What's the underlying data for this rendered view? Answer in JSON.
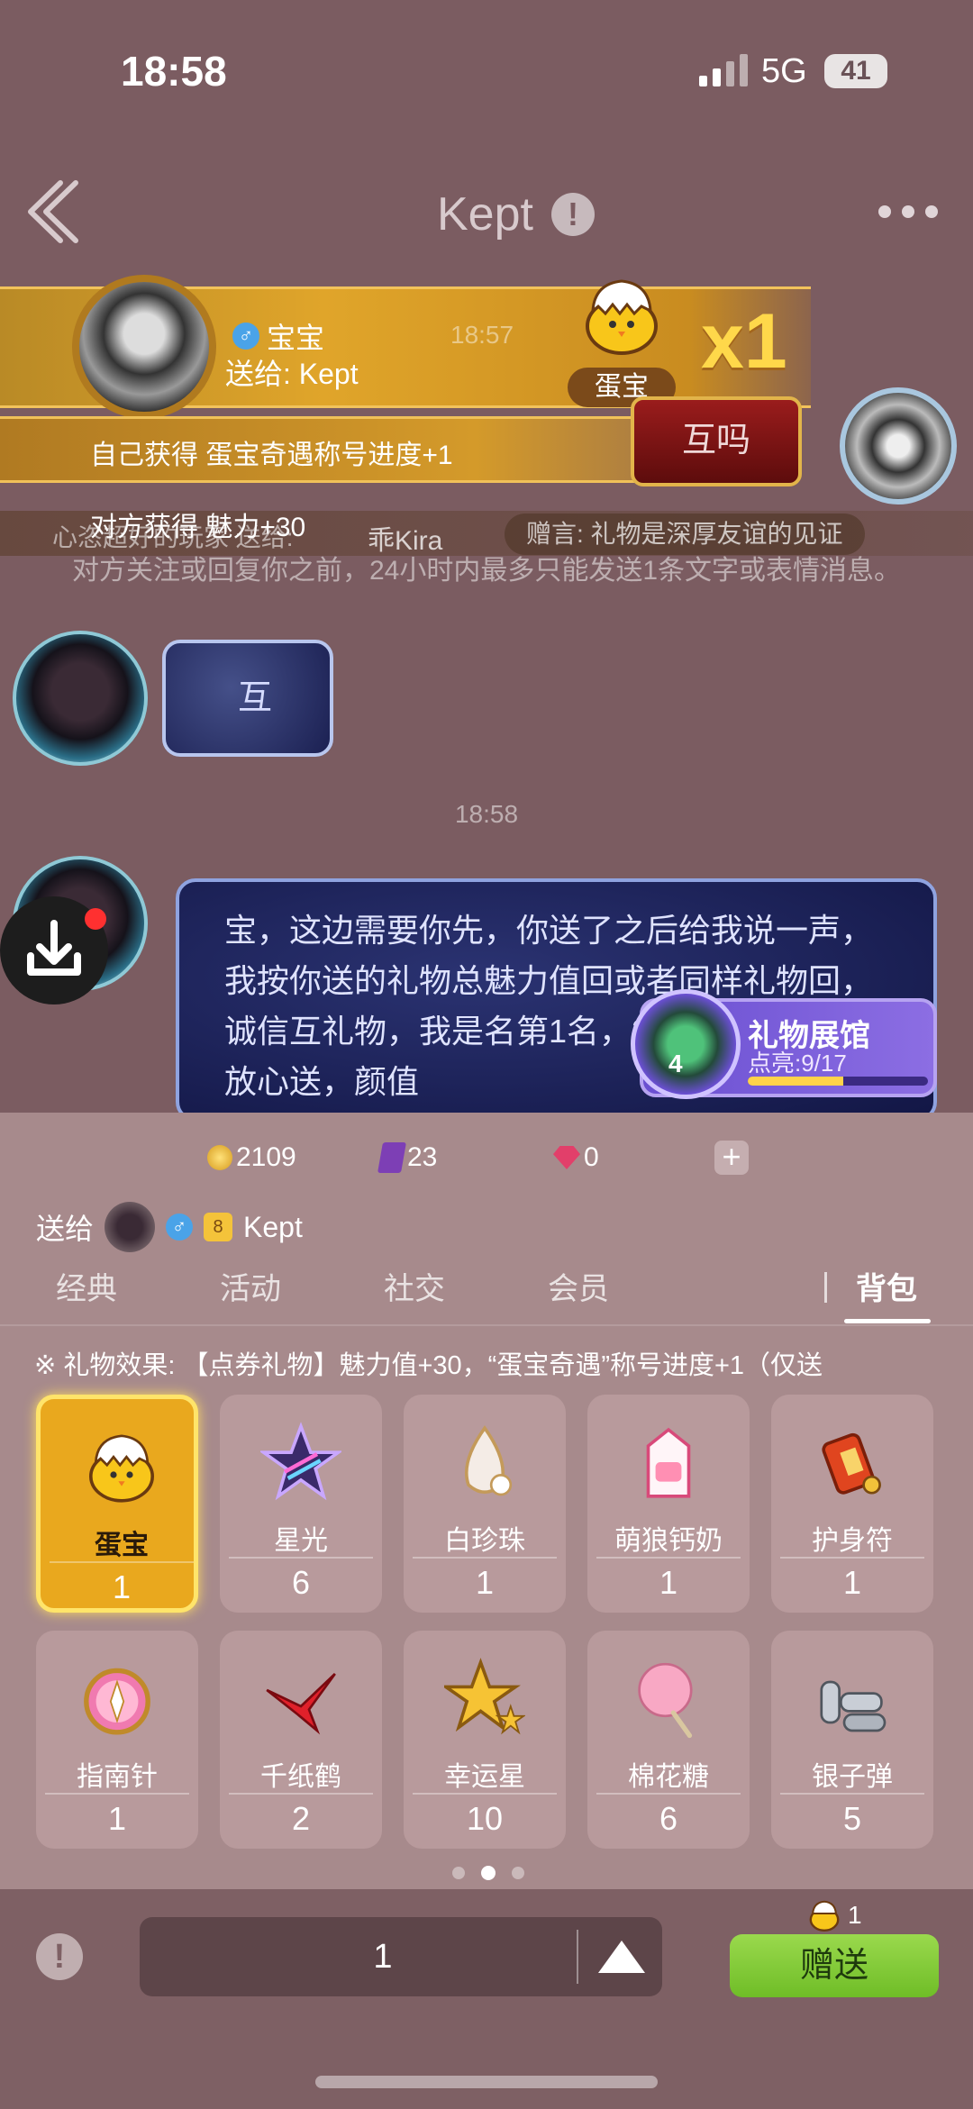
{
  "status_bar": {
    "time": "18:58",
    "network": "5G",
    "battery": "41"
  },
  "header": {
    "title": "Kept"
  },
  "gift_banner": {
    "sender_name": "宝宝",
    "to_text": "送给: Kept",
    "time": "18:57",
    "gift_name": "蛋宝",
    "multiplier": "x1",
    "mutual_badge": "互吗",
    "self_gain": "自己获得   蛋宝奇遇称号进度+1",
    "other_gain": "对方获得   魅力+30"
  },
  "chat": {
    "notice_prefix": "心恣超好的玩家   送给:",
    "notice_user": "乖Kira",
    "notice_msg": "赠言:  礼物是深厚友谊的见证",
    "system_msg": "对方关注或回复你之前，24小时内最多只能发送1条文字或表情消息。",
    "small_bubble": "互",
    "time2": "18:58",
    "big_bubble": "宝，这边需要你先，你送了之后给我说一声，我按你送的礼物总魅力值回或者同样礼物回，诚信互礼物，我是名第1名，2000万魅力值。放心送，颜值"
  },
  "gallery": {
    "title": "礼物展馆",
    "progress_text": "点亮:9/17",
    "progress": 0.53,
    "level": "4"
  },
  "panel": {
    "coins": "2109",
    "tickets": "23",
    "gems": "0",
    "send_to_label": "送给",
    "recipient": "Kept",
    "recipient_level": "8",
    "tabs": [
      {
        "label": "经典"
      },
      {
        "label": "活动"
      },
      {
        "label": "社交"
      },
      {
        "label": "会员"
      },
      {
        "label": "背包"
      }
    ],
    "effect_text": "※ 礼物效果:  【点券礼物】魅力值+30，“蛋宝奇遇”称号进度+1（仅送",
    "gifts": [
      {
        "name": "蛋宝",
        "count": "1",
        "icon": "egg-chick-icon"
      },
      {
        "name": "星光",
        "count": "6",
        "icon": "star-light-icon"
      },
      {
        "name": "白珍珠",
        "count": "1",
        "icon": "pearl-icon"
      },
      {
        "name": "萌狼钙奶",
        "count": "1",
        "icon": "milk-carton-icon"
      },
      {
        "name": "护身符",
        "count": "1",
        "icon": "amulet-icon"
      },
      {
        "name": "指南针",
        "count": "1",
        "icon": "compass-icon"
      },
      {
        "name": "千纸鹤",
        "count": "2",
        "icon": "paper-crane-icon"
      },
      {
        "name": "幸运星",
        "count": "10",
        "icon": "lucky-star-icon"
      },
      {
        "name": "棉花糖",
        "count": "6",
        "icon": "cotton-candy-icon"
      },
      {
        "name": "银子弹",
        "count": "5",
        "icon": "silver-bullet-icon"
      }
    ],
    "quantity": "1",
    "send_count": "1",
    "send_label": "赠送"
  },
  "colors": {
    "selected_gift": "#e9a81e",
    "send_button": "#7ec63a",
    "panel_bg": "#a78a8c"
  }
}
